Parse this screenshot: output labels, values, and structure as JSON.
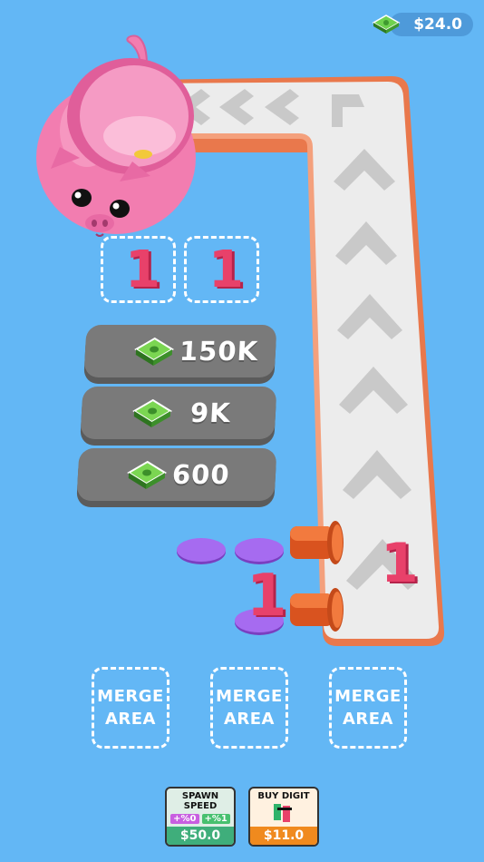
{
  "hud": {
    "money": "$24.0",
    "cash_icon": "cash-stack-icon"
  },
  "stats": [
    {
      "value": "150K",
      "icon": "cash-stack-icon"
    },
    {
      "value": "9K",
      "icon": "cash-stack-icon"
    },
    {
      "value": "600",
      "icon": "cash-stack-icon"
    }
  ],
  "digits": {
    "slot1": "1",
    "slot2": "1",
    "on_pedestal": "1",
    "on_conveyor": "1"
  },
  "merge_areas": [
    {
      "line1": "MERGE",
      "line2": "AREA"
    },
    {
      "line1": "MERGE",
      "line2": "AREA"
    },
    {
      "line1": "MERGE",
      "line2": "AREA"
    }
  ],
  "upgrades": {
    "spawn_speed": {
      "title_line1": "SPAWN",
      "title_line2": "SPEED",
      "chip_left": "+%0",
      "chip_right": "+%1",
      "price": "$50.0"
    },
    "buy_digit": {
      "title": "BUY DIGIT",
      "price": "$11.0"
    }
  },
  "colors": {
    "background": "#63b7f5",
    "conveyor_belt": "#ececec",
    "conveyor_rim": "#f08a5d",
    "pill": "#7a7a7a",
    "digit": "#e8416a",
    "pig": "#f27db0",
    "pad": "#9a5be0",
    "spawn_button": "#4bbf8a",
    "buy_button": "#f08a1e"
  }
}
